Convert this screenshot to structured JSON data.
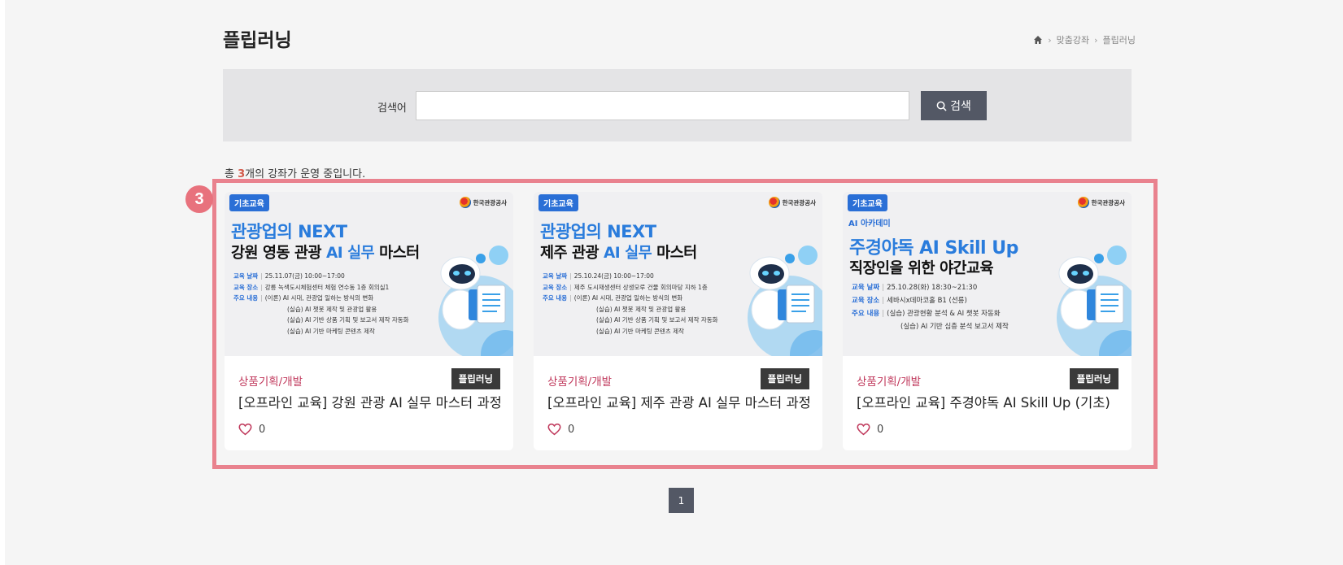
{
  "header": {
    "title": "플립러닝",
    "breadcrumb": [
      "맞춤강좌",
      "플립러닝"
    ],
    "breadcrumb_sep": "›"
  },
  "search": {
    "label": "검색어",
    "value": "",
    "placeholder": "",
    "button_label": "검색"
  },
  "summary": {
    "prefix": "총 ",
    "count": "3",
    "suffix": "개의 강좌가 운영 중입니다."
  },
  "marker": "3",
  "cards": [
    {
      "badge": "기초교육",
      "org": "한국관광공사",
      "academy": "",
      "banner_title": "관광업의 NEXT",
      "banner_sub_pre": "강원 영동 관광 ",
      "banner_sub_hl": "AI 실무",
      "banner_sub_post": " 마스터",
      "info": [
        {
          "key": "교육 날짜",
          "val": "25.11.07(금) 10:00~17:00"
        },
        {
          "key": "교육 장소",
          "val": "강릉 녹색도시체험센터 체험 연수동 1층 회의실1"
        },
        {
          "key": "주요 내용",
          "val": "(이론) AI 시대, 관광업 일하는 방식의 변화"
        }
      ],
      "info_extra": [
        "(실습) AI 챗봇 제작 및 관광업 활용",
        "(실습) AI 기반 상품 기획 및 보고서 제작 자동화",
        "(실습) AI 기반 마케팅 콘텐츠 제작"
      ],
      "category": "상품기획/개발",
      "type": "플립러닝",
      "title": "[오프라인 교육] 강원 관광 AI 실무 마스터 과정",
      "likes": "0"
    },
    {
      "badge": "기초교육",
      "org": "한국관광공사",
      "academy": "",
      "banner_title": "관광업의 NEXT",
      "banner_sub_pre": "제주 관광 ",
      "banner_sub_hl": "AI 실무",
      "banner_sub_post": " 마스터",
      "info": [
        {
          "key": "교육 날짜",
          "val": "25.10.24(금) 10:00~17:00"
        },
        {
          "key": "교육 장소",
          "val": "제주 도시재생센터 상생모루 건물 회의마당 지하 1층"
        },
        {
          "key": "주요 내용",
          "val": "(이론) AI 시대, 관광업 일하는 방식의 변화"
        }
      ],
      "info_extra": [
        "(실습) AI 챗봇 제작 및 관광업 활용",
        "(실습) AI 기반 상품 기획 및 보고서 제작 자동화",
        "(실습) AI 기반 마케팅 콘텐츠 제작"
      ],
      "category": "상품기획/개발",
      "type": "플립러닝",
      "title": "[오프라인 교육] 제주 관광 AI 실무 마스터 과정",
      "likes": "0"
    },
    {
      "badge": "기초교육",
      "org": "한국관광공사",
      "academy": "AI 아카데미",
      "banner_title": "주경야독 AI Skill Up",
      "banner_sub_pre": "직장인을 위한 야간교육",
      "banner_sub_hl": "",
      "banner_sub_post": "",
      "info": [
        {
          "key": "교육 날짜",
          "val": "25.10.28(화) 18:30~21:30"
        },
        {
          "key": "교육 장소",
          "val": "세바시x데마코홀 B1 (선릉)"
        },
        {
          "key": "주요 내용",
          "val": "(실습) 관광현황 분석 & AI 챗봇 자동화"
        }
      ],
      "info_extra": [
        "(실습) AI 기반 심층 분석 보고서 제작"
      ],
      "category": "상품기획/개발",
      "type": "플립러닝",
      "title": "[오프라인 교육] 주경야독 AI Skill Up (기초)",
      "likes": "0"
    }
  ],
  "pagination": {
    "current": "1"
  },
  "colors": {
    "accent_blue": "#2a7cdc",
    "category_red": "#c0395c",
    "highlight": "#e9828e",
    "button_dark": "#535865"
  },
  "icons": [
    "home-icon",
    "search-icon",
    "heart-icon"
  ]
}
